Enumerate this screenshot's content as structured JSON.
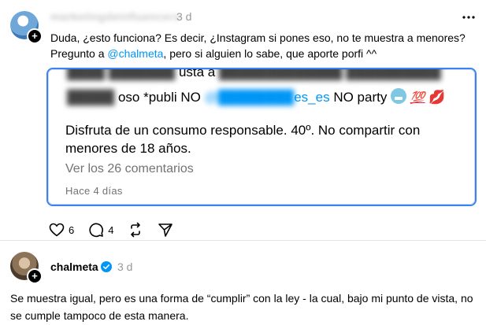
{
  "post1": {
    "username": "marketingdeinfluencers",
    "time": "3 d",
    "text_before": "Duda, ¿esto funciona? Es decir, ¿Instagram si pones eso, no te muestra a menores? Pregunto a ",
    "mention": "@chalmeta",
    "text_after": ", pero si alguien lo sabe, que aporte porfi ^^",
    "embed": {
      "line1_visible": "usta a",
      "line2_prefix": "oso *publi NO ",
      "line2_mention_end": "es_es",
      "line2_suffix": " NO party",
      "emoji_100": "💯",
      "emoji_lips": "💋",
      "body": "Disfruta de un consumo responsable. 40º. No compartir con menores de 18 años.",
      "comments": "Ver los 26 comentarios",
      "date": "Hace 4 días"
    },
    "actions": {
      "likes": "6",
      "replies": "4"
    }
  },
  "post2": {
    "username": "chalmeta",
    "time": "3 d",
    "text": "Se muestra igual, pero es una forma de “cumplir” con la ley - la cual, bajo mi punto de vista, no se cumple tampoco de esta manera."
  },
  "colors": {
    "mention": "#0095f6",
    "embed_border": "#3b82f6",
    "muted": "#737373",
    "verified": "#0095f6"
  }
}
